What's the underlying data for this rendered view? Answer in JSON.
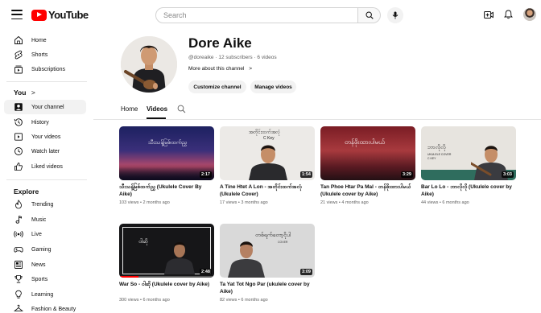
{
  "header": {
    "logo_text": "YouTube",
    "search_placeholder": "Search"
  },
  "sidebar": {
    "main": [
      {
        "label": "Home",
        "icon": "home-icon"
      },
      {
        "label": "Shorts",
        "icon": "shorts-icon"
      },
      {
        "label": "Subscriptions",
        "icon": "subscriptions-icon"
      }
    ],
    "you_heading": "You",
    "you_chevron": ">",
    "you": [
      {
        "label": "Your channel",
        "icon": "your-channel-icon",
        "active": true
      },
      {
        "label": "History",
        "icon": "history-icon"
      },
      {
        "label": "Your videos",
        "icon": "your-videos-icon"
      },
      {
        "label": "Watch later",
        "icon": "watch-later-icon"
      },
      {
        "label": "Liked videos",
        "icon": "liked-videos-icon"
      }
    ],
    "explore_heading": "Explore",
    "explore": [
      {
        "label": "Trending",
        "icon": "trending-icon"
      },
      {
        "label": "Music",
        "icon": "music-icon"
      },
      {
        "label": "Live",
        "icon": "live-icon"
      },
      {
        "label": "Gaming",
        "icon": "gaming-icon"
      },
      {
        "label": "News",
        "icon": "news-icon"
      },
      {
        "label": "Sports",
        "icon": "sports-icon"
      },
      {
        "label": "Learning",
        "icon": "learning-icon"
      },
      {
        "label": "Fashion & Beauty",
        "icon": "fashion-icon"
      }
    ]
  },
  "channel": {
    "name": "Dore Aike",
    "handle": "@doreaike",
    "subscribers": "12 subscribers",
    "videos_count": "6 videos",
    "about": "More about this channel",
    "about_chevron": ">",
    "customize_label": "Customize channel",
    "manage_label": "Manage videos"
  },
  "tabs": [
    {
      "label": "Home",
      "active": false
    },
    {
      "label": "Videos",
      "active": true
    }
  ],
  "videos": [
    {
      "title": "သီးသန့်မြစ်ထက်ညွှ (Ukulele Cover By Aike)",
      "views": "103 views",
      "age": "2 months ago",
      "duration": "2:17",
      "thumb_caption": "သီးသန့်မြစ်ထက်ညွှ"
    },
    {
      "title": "A Tine Htet A Lon - အတိုင်းထက်အလုံ (Ukulele Cover)",
      "views": "17 views",
      "age": "3 months ago",
      "duration": "1:54",
      "thumb_caption": "အတိုင်းထက်အလုံ",
      "thumb_key": "C Key"
    },
    {
      "title": "Tan Phoe Htar Pa Mal - တန်ဖိုးထားပါမယ် (Ukulele cover by Aike)",
      "views": "21 views",
      "age": "4 months ago",
      "duration": "3:29",
      "thumb_caption": "တန်ဖိုးထားပါမယ်"
    },
    {
      "title": "Bar Lo Lo - ဘာလိုလို (Ukulele cover by Aike)",
      "views": "44 views",
      "age": "6 months ago",
      "duration": "3:03",
      "thumb_caption": "ဘာလိုလို",
      "thumb_sub": "UKULELE COVER",
      "thumb_key": "C KEY"
    },
    {
      "title": "War So - ဝါဆို (Ukulele cover by Aike)",
      "views": "300 views",
      "age": "6 months ago",
      "duration": "2:48",
      "thumb_caption": "ဝါဆို"
    },
    {
      "title": "Ta Yat Tot Ngo Par (ukulele cover by Aike)",
      "views": "82 views",
      "age": "6 months ago",
      "duration": "3:09",
      "thumb_caption": "တစ်ရက်တော့ငိုပါ",
      "thumb_sub": "COVER"
    }
  ]
}
